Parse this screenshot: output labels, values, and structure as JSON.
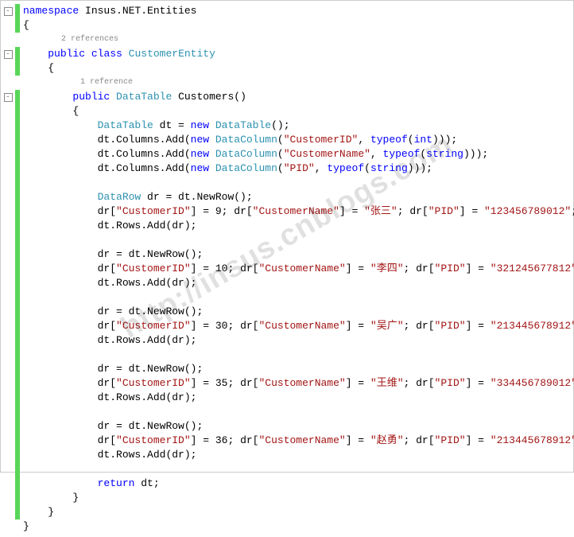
{
  "watermark": "http://insus.cnblogs.com",
  "refs": {
    "class": "2 references",
    "method": "1 reference"
  },
  "lines": [
    {
      "gutter": "box",
      "bar": true,
      "indent": 0,
      "tokens": [
        {
          "c": "kw",
          "t": "namespace"
        },
        {
          "t": " Insus.NET.Entities"
        }
      ]
    },
    {
      "bar": true,
      "indent": 0,
      "tokens": [
        {
          "t": "{"
        }
      ]
    },
    {
      "bar": false,
      "ref": "class",
      "indent": 2
    },
    {
      "gutter": "box",
      "bar": true,
      "indent": 1,
      "tokens": [
        {
          "c": "kw",
          "t": "public"
        },
        {
          "t": " "
        },
        {
          "c": "kw",
          "t": "class"
        },
        {
          "t": " "
        },
        {
          "c": "type",
          "t": "CustomerEntity"
        }
      ]
    },
    {
      "bar": true,
      "indent": 1,
      "tokens": [
        {
          "t": "{"
        }
      ]
    },
    {
      "bar": false,
      "ref": "method",
      "indent": 3
    },
    {
      "gutter": "box",
      "bar": true,
      "indent": 2,
      "tokens": [
        {
          "c": "kw",
          "t": "public"
        },
        {
          "t": " "
        },
        {
          "c": "type",
          "t": "DataTable"
        },
        {
          "t": " Customers()"
        }
      ]
    },
    {
      "bar": true,
      "indent": 2,
      "tokens": [
        {
          "t": "{"
        }
      ]
    },
    {
      "bar": true,
      "indent": 3,
      "tokens": [
        {
          "c": "type",
          "t": "DataTable"
        },
        {
          "t": " dt = "
        },
        {
          "c": "kw",
          "t": "new"
        },
        {
          "t": " "
        },
        {
          "c": "type",
          "t": "DataTable"
        },
        {
          "t": "();"
        }
      ]
    },
    {
      "bar": true,
      "indent": 3,
      "tokens": [
        {
          "t": "dt.Columns.Add("
        },
        {
          "c": "kw",
          "t": "new"
        },
        {
          "t": " "
        },
        {
          "c": "type",
          "t": "DataColumn"
        },
        {
          "t": "("
        },
        {
          "c": "str",
          "t": "\"CustomerID\""
        },
        {
          "t": ", "
        },
        {
          "c": "kw",
          "t": "typeof"
        },
        {
          "t": "("
        },
        {
          "c": "kw",
          "t": "int"
        },
        {
          "t": ")));"
        }
      ]
    },
    {
      "bar": true,
      "indent": 3,
      "tokens": [
        {
          "t": "dt.Columns.Add("
        },
        {
          "c": "kw",
          "t": "new"
        },
        {
          "t": " "
        },
        {
          "c": "type",
          "t": "DataColumn"
        },
        {
          "t": "("
        },
        {
          "c": "str",
          "t": "\"CustomerName\""
        },
        {
          "t": ", "
        },
        {
          "c": "kw",
          "t": "typeof"
        },
        {
          "t": "("
        },
        {
          "c": "kw",
          "t": "string"
        },
        {
          "t": ")));"
        }
      ]
    },
    {
      "bar": true,
      "indent": 3,
      "tokens": [
        {
          "t": "dt.Columns.Add("
        },
        {
          "c": "kw",
          "t": "new"
        },
        {
          "t": " "
        },
        {
          "c": "type",
          "t": "DataColumn"
        },
        {
          "t": "("
        },
        {
          "c": "str",
          "t": "\"PID\""
        },
        {
          "t": ", "
        },
        {
          "c": "kw",
          "t": "typeof"
        },
        {
          "t": "("
        },
        {
          "c": "kw",
          "t": "string"
        },
        {
          "t": ")));"
        }
      ]
    },
    {
      "bar": true,
      "indent": 3,
      "tokens": []
    },
    {
      "bar": true,
      "indent": 3,
      "tokens": [
        {
          "c": "type",
          "t": "DataRow"
        },
        {
          "t": " dr = dt.NewRow();"
        }
      ]
    },
    {
      "bar": true,
      "indent": 3,
      "tokens": [
        {
          "t": "dr["
        },
        {
          "c": "str",
          "t": "\"CustomerID\""
        },
        {
          "t": "] = 9; dr["
        },
        {
          "c": "str",
          "t": "\"CustomerName\""
        },
        {
          "t": "] = "
        },
        {
          "c": "str",
          "t": "\"张三\""
        },
        {
          "t": "; dr["
        },
        {
          "c": "str",
          "t": "\"PID\""
        },
        {
          "t": "] = "
        },
        {
          "c": "str",
          "t": "\"123456789012\""
        },
        {
          "t": ";"
        }
      ]
    },
    {
      "bar": true,
      "indent": 3,
      "tokens": [
        {
          "t": "dt.Rows.Add(dr);"
        }
      ]
    },
    {
      "bar": true,
      "indent": 3,
      "tokens": []
    },
    {
      "bar": true,
      "indent": 3,
      "tokens": [
        {
          "t": "dr = dt.NewRow();"
        }
      ]
    },
    {
      "bar": true,
      "indent": 3,
      "tokens": [
        {
          "t": "dr["
        },
        {
          "c": "str",
          "t": "\"CustomerID\""
        },
        {
          "t": "] = 10; dr["
        },
        {
          "c": "str",
          "t": "\"CustomerName\""
        },
        {
          "t": "] = "
        },
        {
          "c": "str",
          "t": "\"李四\""
        },
        {
          "t": "; dr["
        },
        {
          "c": "str",
          "t": "\"PID\""
        },
        {
          "t": "] = "
        },
        {
          "c": "str",
          "t": "\"321245677812\""
        },
        {
          "t": ";"
        }
      ]
    },
    {
      "bar": true,
      "indent": 3,
      "tokens": [
        {
          "t": "dt.Rows.Add(dr);"
        }
      ]
    },
    {
      "bar": true,
      "indent": 3,
      "tokens": []
    },
    {
      "bar": true,
      "indent": 3,
      "tokens": [
        {
          "t": "dr = dt.NewRow();"
        }
      ]
    },
    {
      "bar": true,
      "indent": 3,
      "tokens": [
        {
          "t": "dr["
        },
        {
          "c": "str",
          "t": "\"CustomerID\""
        },
        {
          "t": "] = 30; dr["
        },
        {
          "c": "str",
          "t": "\"CustomerName\""
        },
        {
          "t": "] = "
        },
        {
          "c": "str",
          "t": "\"吴广\""
        },
        {
          "t": "; dr["
        },
        {
          "c": "str",
          "t": "\"PID\""
        },
        {
          "t": "] = "
        },
        {
          "c": "str",
          "t": "\"213445678912\""
        },
        {
          "t": ";"
        }
      ]
    },
    {
      "bar": true,
      "indent": 3,
      "tokens": [
        {
          "t": "dt.Rows.Add(dr);"
        }
      ]
    },
    {
      "bar": true,
      "indent": 3,
      "tokens": []
    },
    {
      "bar": true,
      "indent": 3,
      "tokens": [
        {
          "t": "dr = dt.NewRow();"
        }
      ]
    },
    {
      "bar": true,
      "indent": 3,
      "tokens": [
        {
          "t": "dr["
        },
        {
          "c": "str",
          "t": "\"CustomerID\""
        },
        {
          "t": "] = 35; dr["
        },
        {
          "c": "str",
          "t": "\"CustomerName\""
        },
        {
          "t": "] = "
        },
        {
          "c": "str",
          "t": "\"王维\""
        },
        {
          "t": "; dr["
        },
        {
          "c": "str",
          "t": "\"PID\""
        },
        {
          "t": "] = "
        },
        {
          "c": "str",
          "t": "\"334456789012\""
        },
        {
          "t": ";"
        }
      ]
    },
    {
      "bar": true,
      "indent": 3,
      "tokens": [
        {
          "t": "dt.Rows.Add(dr);"
        }
      ]
    },
    {
      "bar": true,
      "indent": 3,
      "tokens": []
    },
    {
      "bar": true,
      "indent": 3,
      "tokens": [
        {
          "t": "dr = dt.NewRow();"
        }
      ]
    },
    {
      "bar": true,
      "indent": 3,
      "tokens": [
        {
          "t": "dr["
        },
        {
          "c": "str",
          "t": "\"CustomerID\""
        },
        {
          "t": "] = 36; dr["
        },
        {
          "c": "str",
          "t": "\"CustomerName\""
        },
        {
          "t": "] = "
        },
        {
          "c": "str",
          "t": "\"赵勇\""
        },
        {
          "t": "; dr["
        },
        {
          "c": "str",
          "t": "\"PID\""
        },
        {
          "t": "] = "
        },
        {
          "c": "str",
          "t": "\"213445678912\""
        },
        {
          "t": ";"
        }
      ]
    },
    {
      "bar": true,
      "indent": 3,
      "tokens": [
        {
          "t": "dt.Rows.Add(dr);"
        }
      ]
    },
    {
      "bar": true,
      "indent": 3,
      "tokens": []
    },
    {
      "bar": true,
      "indent": 3,
      "tokens": [
        {
          "c": "kw",
          "t": "return"
        },
        {
          "t": " dt;"
        }
      ]
    },
    {
      "bar": true,
      "indent": 2,
      "tokens": [
        {
          "t": "}"
        }
      ]
    },
    {
      "bar": true,
      "indent": 1,
      "tokens": [
        {
          "t": "}"
        }
      ]
    },
    {
      "bar": false,
      "indent": 0,
      "tokens": [
        {
          "t": "}"
        }
      ]
    }
  ]
}
